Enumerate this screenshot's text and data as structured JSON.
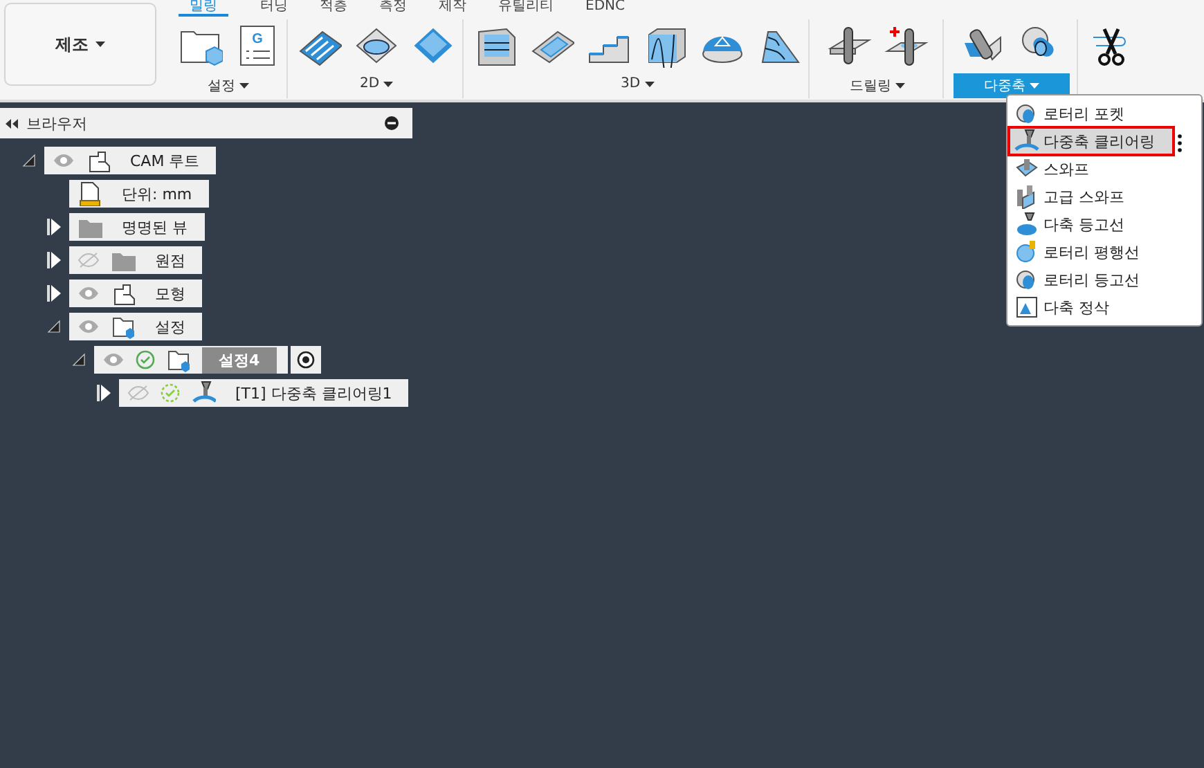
{
  "manufacture_button": {
    "label": "제조"
  },
  "tabs": [
    {
      "label": "밀링",
      "selected": true
    },
    {
      "label": "터닝",
      "selected": false
    },
    {
      "label": "적층",
      "selected": false
    },
    {
      "label": "측정",
      "selected": false
    },
    {
      "label": "제작",
      "selected": false
    },
    {
      "label": "유틸리티",
      "selected": false
    },
    {
      "label": "EDNC",
      "selected": false
    }
  ],
  "panels": [
    {
      "label": "설정",
      "active": false,
      "tools": [
        {
          "kind": "setup"
        },
        {
          "kind": "nc",
          "letter": "G"
        }
      ]
    },
    {
      "label": "2D",
      "active": false,
      "tools": [
        {
          "kind": "adaptive2d"
        },
        {
          "kind": "pocket2d"
        },
        {
          "kind": "face"
        }
      ]
    },
    {
      "label": "3D",
      "active": false,
      "tools": [
        {
          "kind": "adaptive3d"
        },
        {
          "kind": "pocket3d"
        },
        {
          "kind": "steep"
        },
        {
          "kind": "contour"
        },
        {
          "kind": "dome"
        },
        {
          "kind": "scallop"
        }
      ]
    },
    {
      "label": "드릴링",
      "active": false,
      "tools": [
        {
          "kind": "drill"
        },
        {
          "kind": "drilladd"
        }
      ]
    },
    {
      "label": "다중축",
      "active": true,
      "tools": [
        {
          "kind": "multiaxis"
        },
        {
          "kind": "rotary"
        }
      ]
    },
    {
      "tools": [
        {
          "kind": "scissors"
        }
      ]
    }
  ],
  "browser": {
    "title": "브라우저"
  },
  "tree": [
    {
      "label": "CAM 루트",
      "kind": "component",
      "expanded": true,
      "visible": true,
      "children": [
        {
          "label": "단위: mm",
          "kind": "units"
        },
        {
          "label": "명명된 뷰",
          "kind": "folder",
          "expanded": false
        },
        {
          "label": "원점",
          "kind": "folder",
          "expanded": false,
          "visible": false
        },
        {
          "label": "모형",
          "kind": "component",
          "expanded": false,
          "visible": true
        },
        {
          "label": "설정",
          "kind": "setup",
          "expanded": true,
          "visible": true,
          "children": [
            {
              "label": "설정4",
              "kind": "setup",
              "expanded": true,
              "visible": true,
              "generated": true,
              "active": true,
              "target": true,
              "children": [
                {
                  "label": "[T1] 다중축 클리어링1",
                  "kind": "tool",
                  "expanded": false,
                  "visible": false,
                  "generated": false
                }
              ]
            }
          ]
        }
      ]
    }
  ],
  "menu": [
    {
      "label": "로터리 포켓",
      "kind": "rotary",
      "selected": false
    },
    {
      "label": "다중축 클리어링",
      "kind": "tool",
      "selected": true
    },
    {
      "label": "스와프",
      "kind": "swarf",
      "selected": false
    },
    {
      "label": "고급 스와프",
      "kind": "swarf2",
      "selected": false
    },
    {
      "label": "다축 등고선",
      "kind": "tool2",
      "selected": false
    },
    {
      "label": "로터리 평행선",
      "kind": "rotary2",
      "selected": false
    },
    {
      "label": "로터리 등고선",
      "kind": "rotary",
      "selected": false
    },
    {
      "label": "다축 정삭",
      "kind": "finish",
      "selected": false
    }
  ]
}
